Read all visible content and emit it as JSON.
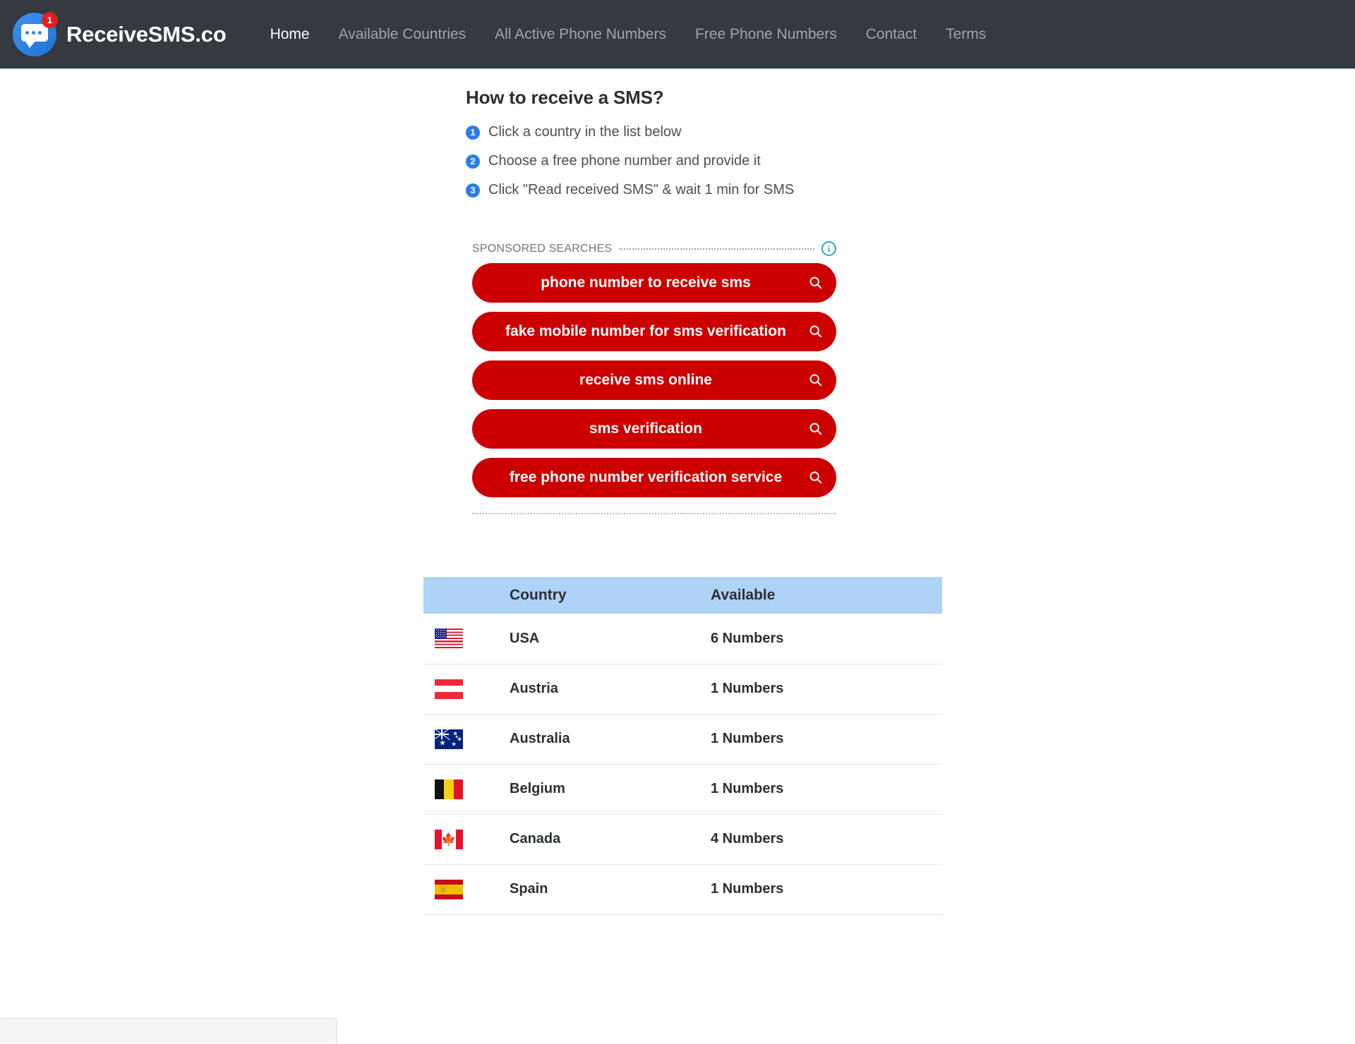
{
  "navbar": {
    "brand": {
      "name": "ReceiveSMS.co",
      "badge_count": "1",
      "logo_icon": "chat-bubble-icon"
    },
    "links": [
      {
        "label": "Home",
        "active": true
      },
      {
        "label": "Available Countries",
        "active": false
      },
      {
        "label": "All Active Phone Numbers",
        "active": false
      },
      {
        "label": "Free Phone Numbers",
        "active": false
      },
      {
        "label": "Contact",
        "active": false
      },
      {
        "label": "Terms",
        "active": false
      }
    ],
    "background_color": "#343a40",
    "active_link_color": "#ffffff",
    "link_color": "#9ea4a9"
  },
  "howto": {
    "title": "How to receive a SMS?",
    "steps": [
      {
        "num": "1",
        "text": "Click a country in the list below"
      },
      {
        "num": "2",
        "text": "Choose a free phone number and provide it"
      },
      {
        "num": "3",
        "text": "Click \"Read received SMS\" & wait 1 min for SMS"
      }
    ],
    "step_badge_color": "#2b7de9"
  },
  "sponsored": {
    "label": "SPONSORED SEARCHES",
    "info_icon": "info-circle-icon",
    "info_icon_color": "#2aa8b8",
    "pill_color": "#cc0000",
    "items": [
      {
        "label": "phone number to receive sms",
        "icon": "search-icon"
      },
      {
        "label": "fake mobile number for sms verification",
        "icon": "search-icon"
      },
      {
        "label": "receive sms online",
        "icon": "search-icon"
      },
      {
        "label": "sms verification",
        "icon": "search-icon"
      },
      {
        "label": "free phone number verification service",
        "icon": "search-icon"
      }
    ]
  },
  "country_table": {
    "header_background": "#afd3f7",
    "columns": [
      "",
      "Country",
      "Available"
    ],
    "rows": [
      {
        "flag": "usa-flag",
        "country": "USA",
        "available": "6 Numbers"
      },
      {
        "flag": "austria-flag",
        "country": "Austria",
        "available": "1 Numbers"
      },
      {
        "flag": "australia-flag",
        "country": "Australia",
        "available": "1 Numbers"
      },
      {
        "flag": "belgium-flag",
        "country": "Belgium",
        "available": "1 Numbers"
      },
      {
        "flag": "canada-flag",
        "country": "Canada",
        "available": "4 Numbers"
      },
      {
        "flag": "spain-flag",
        "country": "Spain",
        "available": "1 Numbers"
      }
    ]
  }
}
